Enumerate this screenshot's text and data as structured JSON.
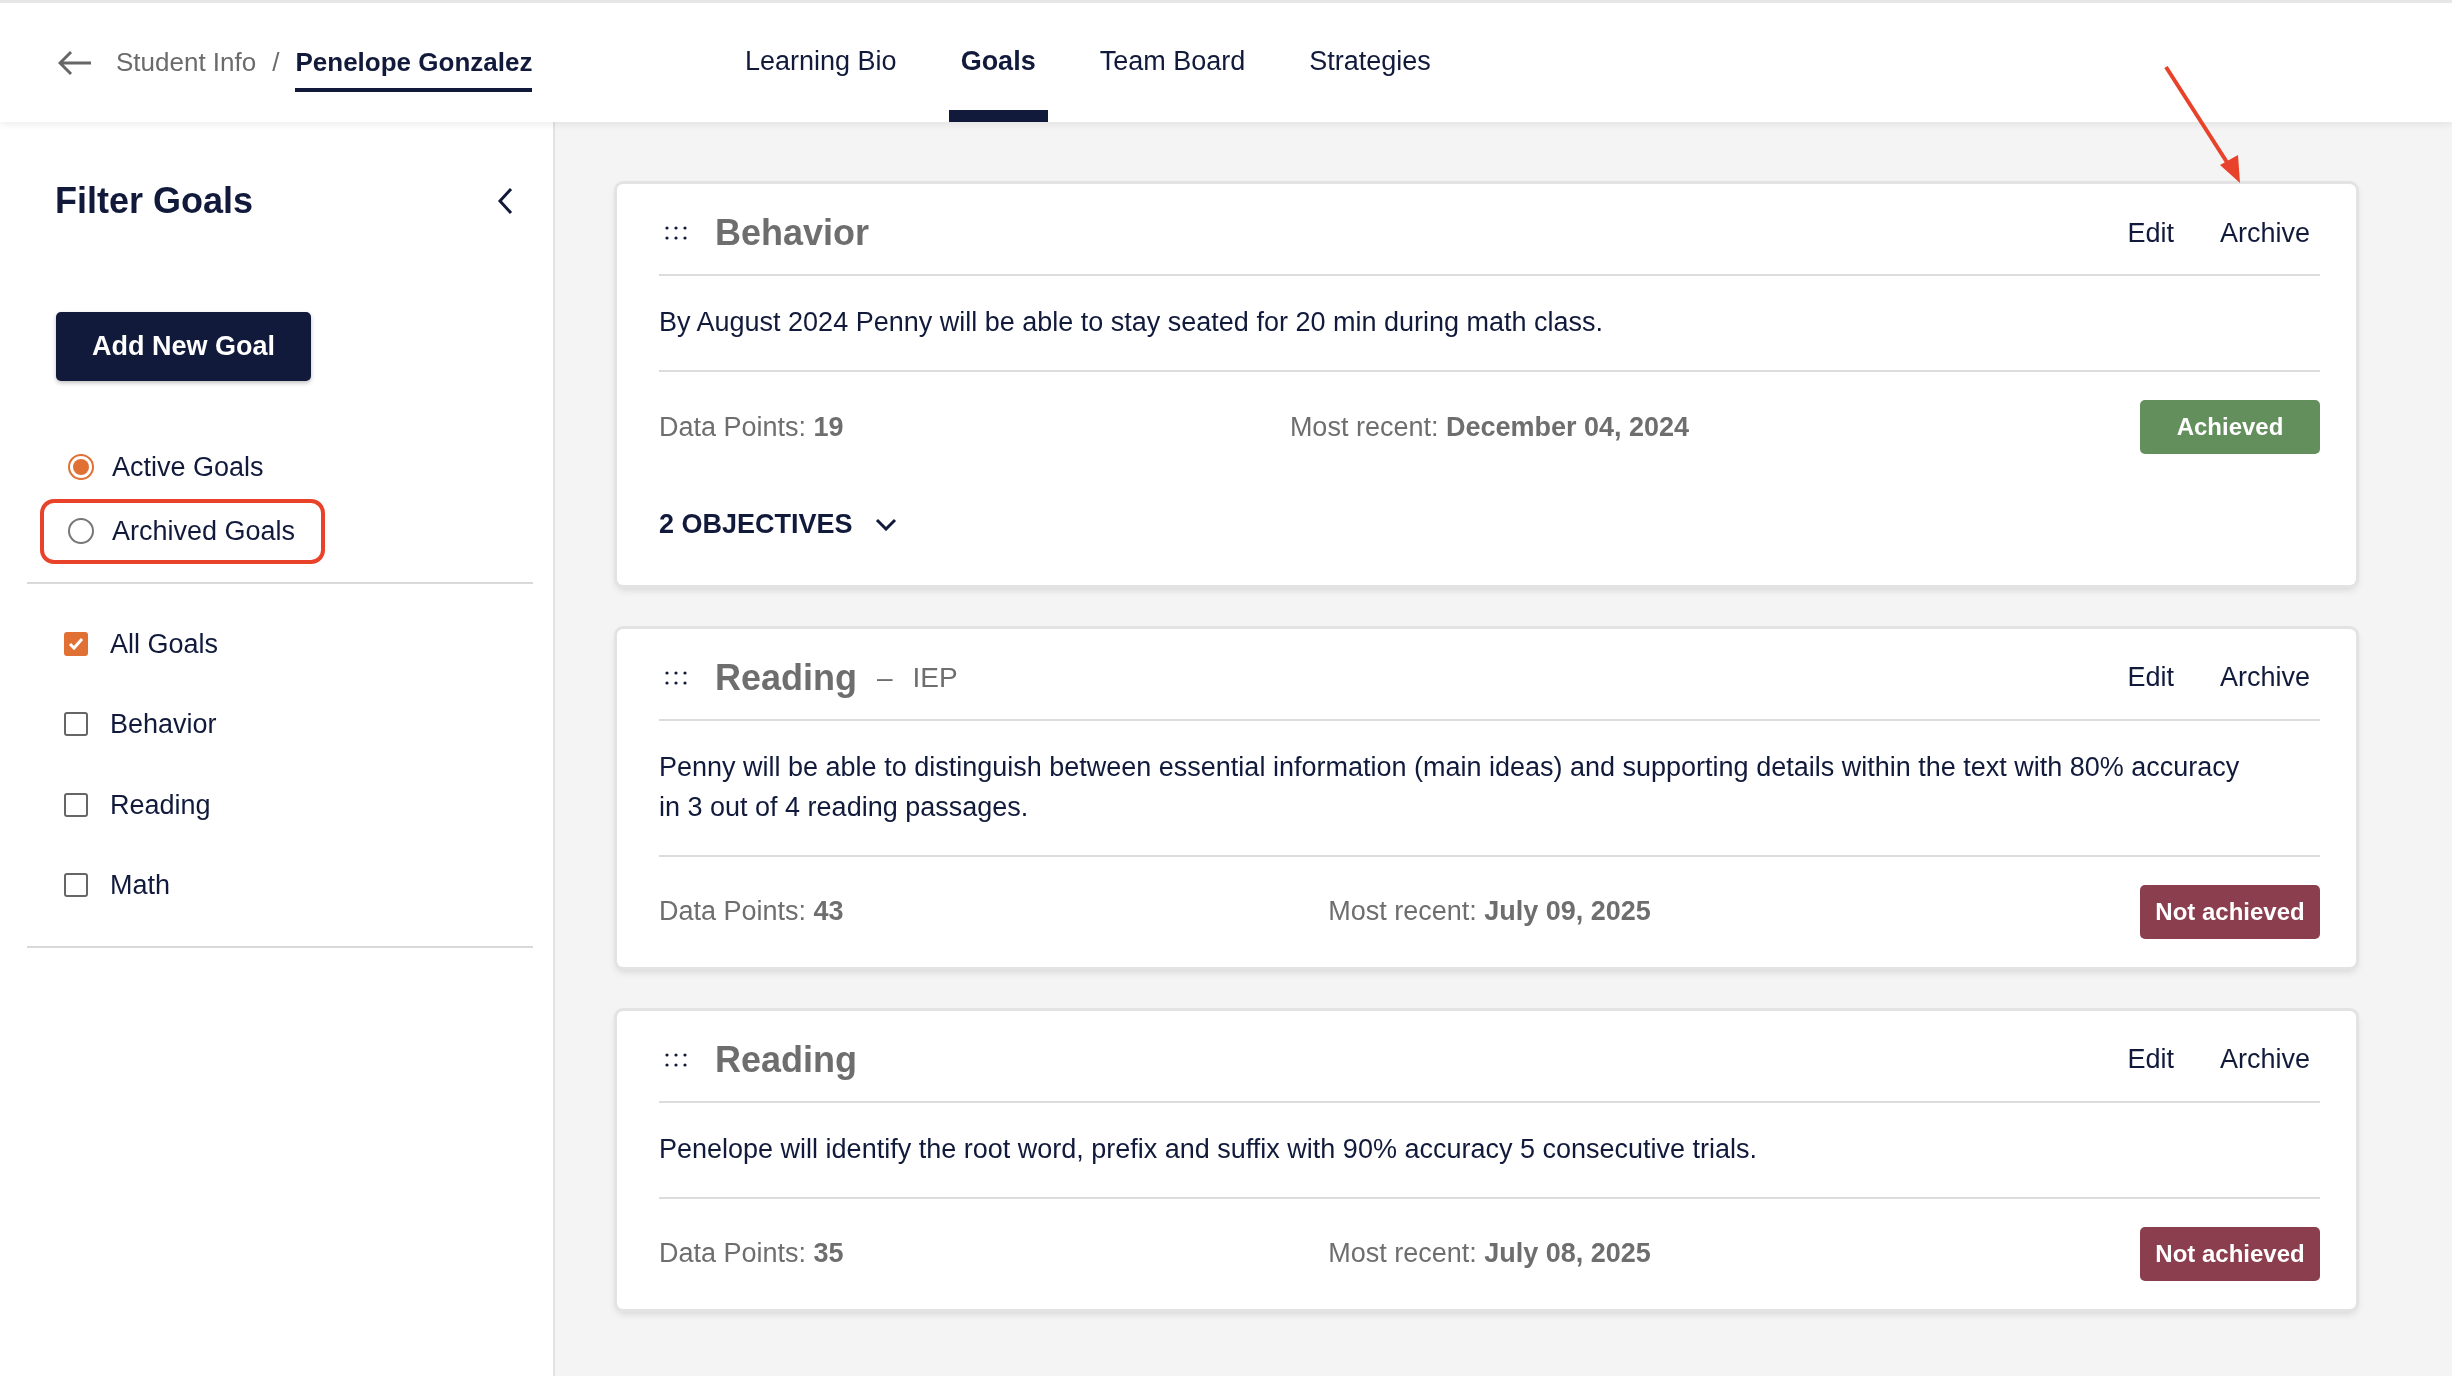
{
  "breadcrumb": {
    "parent": "Student Info",
    "separator": "/",
    "current": "Penelope Gonzalez"
  },
  "tabs": [
    {
      "label": "Learning Bio",
      "selected": false
    },
    {
      "label": "Goals",
      "selected": true
    },
    {
      "label": "Team Board",
      "selected": false
    },
    {
      "label": "Strategies",
      "selected": false
    }
  ],
  "sidebar": {
    "title": "Filter Goals",
    "add_button": "Add New Goal",
    "goal_status": [
      {
        "label": "Active Goals",
        "selected": true,
        "highlighted": false
      },
      {
        "label": "Archived Goals",
        "selected": false,
        "highlighted": true
      }
    ],
    "categories": [
      {
        "label": "All Goals",
        "checked": true
      },
      {
        "label": "Behavior",
        "checked": false
      },
      {
        "label": "Reading",
        "checked": false
      },
      {
        "label": "Math",
        "checked": false
      }
    ]
  },
  "goals": [
    {
      "category": "Behavior",
      "actions": [
        {
          "label": "Edit",
          "highlighted": false
        },
        {
          "label": "Archive",
          "highlighted": true
        }
      ],
      "description": "By August 2024 Penny will be able to stay seated for 20 min during math class.",
      "data_points": "Data Points: **19**",
      "most_recent": "Most recent: **December 04, 2024**",
      "status": "Achieved",
      "color": "#628f5c",
      "objectives": "2 OBJECTIVES"
    },
    {
      "category": "Reading",
      "separator": "–",
      "tag": "IEP",
      "actions": [
        {
          "label": "Edit",
          "highlighted": false
        },
        {
          "label": "Archive",
          "highlighted": false
        }
      ],
      "description": "Penny will be able to distinguish between essential information (main ideas) and supporting details within the text with 80% accuracy in 3 out of 4 reading passages.",
      "data_points": "Data Points: **43**",
      "most_recent": "Most recent: **July 09, 2025**",
      "status": "Not achieved",
      "color": "#8b3e4e"
    },
    {
      "category": "Reading",
      "actions": [
        {
          "label": "Edit",
          "highlighted": false
        },
        {
          "label": "Archive",
          "highlighted": false
        }
      ],
      "description": "Penelope will identify the root word, prefix and suffix with 90% accuracy 5 consecutive trials.",
      "data_points": "Data Points: **35**",
      "most_recent": "Most recent: **July 08, 2025**",
      "status": "Not achieved",
      "color": "#8b3e4e"
    }
  ]
}
